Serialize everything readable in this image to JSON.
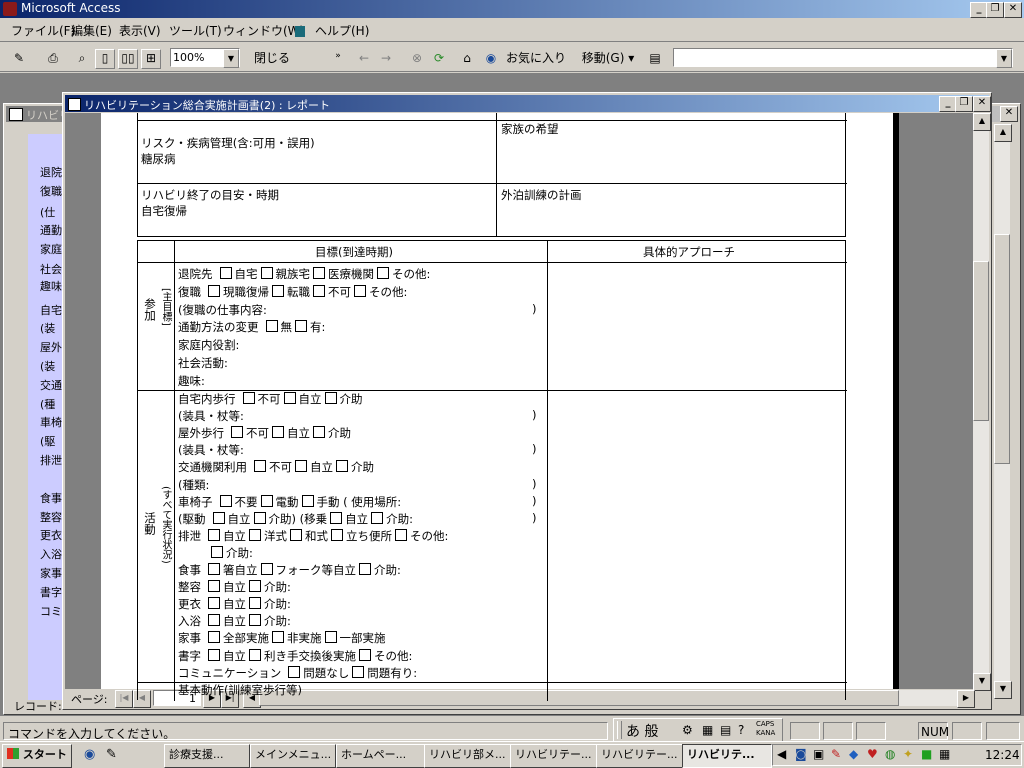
{
  "app_title": "Microsoft Access",
  "menu": [
    "ファイル(F)",
    "編集(E)",
    "表示(V)",
    "ツール(T)",
    "ウィンドウ(W)",
    "ヘルプ(H)"
  ],
  "toolbar": {
    "zoom": "100%",
    "close_label": "閉じる(C)",
    "favorites": "お気に入り",
    "go": "移動(G)",
    "address": ""
  },
  "bg_window_title": "リハビリ",
  "sidebar_items": [
    "退院",
    "復職",
    "(仕",
    "通勤",
    "家庭",
    "社会",
    "趣味",
    "自宅",
    "(装",
    "屋外",
    "(装",
    "交通",
    "(種",
    "車椅",
    "(駆",
    "排泄",
    "食事",
    "整容",
    "更衣",
    "入浴",
    "家事",
    "書字",
    "コミ"
  ],
  "record_label": "レコード:",
  "report": {
    "title": "リハビリテーション総合実施計画書(2) : レポート",
    "top": {
      "family_wish": "家族の希望",
      "risk_label": "リスク・疾病管理(含:可用・誤用)",
      "risk_value": "糖尿病",
      "end_label": "リハビリ終了の目安・時期",
      "end_value": "自宅復帰",
      "outing_label": "外泊訓練の計画"
    },
    "table": {
      "col_goal": "目標(到達時期)",
      "col_approach": "具体的アプローチ",
      "section1_side": "参加",
      "section1_bracket": "[主目標]",
      "section2_side": "活動",
      "section2_bracket": "(すべて実行状況)",
      "participation": [
        {
          "label": "退院先",
          "opts": [
            "自宅",
            "親族宅",
            "医療機関",
            "その他:"
          ]
        },
        {
          "label": "復職",
          "opts": [
            "現職復帰",
            "転職",
            "不可",
            "その他:"
          ]
        },
        {
          "label": "(復職の仕事内容:",
          "opts": [],
          "close": ")"
        },
        {
          "label": "通勤方法の変更",
          "opts": [
            "無",
            "有:"
          ]
        },
        {
          "label": "家庭内役割:",
          "opts": []
        },
        {
          "label": "社会活動:",
          "opts": []
        },
        {
          "label": "趣味:",
          "opts": []
        }
      ],
      "activity": [
        {
          "label": "自宅内歩行",
          "opts": [
            "不可",
            "自立",
            "介助"
          ]
        },
        {
          "label": "(装具・杖等:",
          "opts": [],
          "close": ")"
        },
        {
          "label": "屋外歩行",
          "opts": [
            "不可",
            "自立",
            "介助"
          ]
        },
        {
          "label": "(装具・杖等:",
          "opts": [],
          "close": ")"
        },
        {
          "label": "交通機関利用",
          "opts": [
            "不可",
            "自立",
            "介助"
          ]
        },
        {
          "label": "(種類:",
          "opts": [],
          "close": ")"
        },
        {
          "label": "車椅子",
          "opts": [
            "不要",
            "電動",
            "手動 ( 使用場所:"
          ],
          "close": ")"
        },
        {
          "label": "(駆動",
          "opts": [
            "自立",
            "介助) (移乗",
            "自立",
            "介助:"
          ],
          "close": ")"
        },
        {
          "label": "排泄",
          "opts": [
            "自立",
            "洋式",
            "和式",
            "立ち便所",
            "その他:"
          ]
        },
        {
          "label": "",
          "opts": [
            "介助:"
          ]
        },
        {
          "label": "食事",
          "opts": [
            "箸自立",
            "フォーク等自立",
            "介助:"
          ]
        },
        {
          "label": "整容",
          "opts": [
            "自立",
            "介助:"
          ]
        },
        {
          "label": "更衣",
          "opts": [
            "自立",
            "介助:"
          ]
        },
        {
          "label": "入浴",
          "opts": [
            "自立",
            "介助:"
          ]
        },
        {
          "label": "家事",
          "opts": [
            "全部実施",
            "非実施",
            "一部実施"
          ]
        },
        {
          "label": "書字",
          "opts": [
            "自立",
            "利き手交換後実施",
            "その他:"
          ]
        },
        {
          "label": "コミュニケーション",
          "opts": [
            "問題なし",
            "問題有り:"
          ]
        },
        {
          "label": "基本動作(訓練室歩行等)",
          "opts": []
        }
      ]
    },
    "page_label": "ページ:",
    "page_num": "1"
  },
  "status": {
    "command": "コマンドを入力してください。",
    "ime": "あ 般",
    "caps": "CAPS KANA",
    "num": "NUM"
  },
  "taskbar": {
    "start": "スタート",
    "tasks": [
      "診療支援...",
      "メインメニュ...",
      "ホームペー...",
      "リハビリ部メ...",
      "リハビリテー...",
      "リハビリテー...",
      "リハビリテ..."
    ],
    "clock": "12:24"
  }
}
